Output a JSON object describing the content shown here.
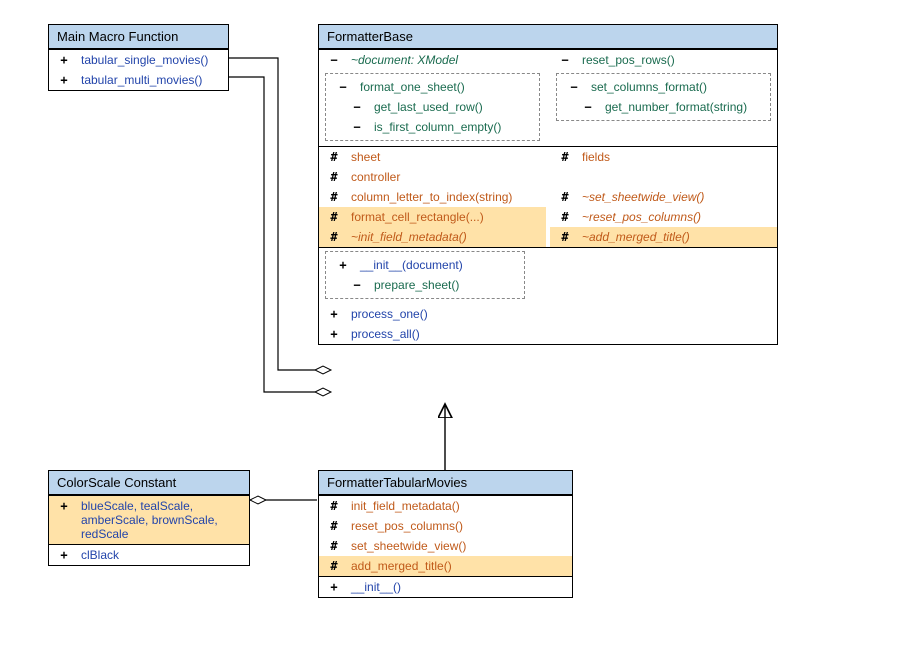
{
  "boxes": {
    "macro": {
      "title": "Main Macro Function",
      "items": [
        {
          "sym": "+",
          "cls": "public",
          "label": "tabular_single_movies()"
        },
        {
          "sym": "+",
          "cls": "public",
          "label": "tabular_multi_movies()"
        }
      ]
    },
    "colorscale": {
      "title": "ColorScale Constant",
      "items_hl": [
        {
          "sym": "+",
          "cls": "public",
          "label": "blueScale, tealScale, amberScale, brownScale, redScale"
        }
      ],
      "items": [
        {
          "sym": "+",
          "cls": "public",
          "label": "clBlack"
        }
      ]
    },
    "fbase": {
      "title": "FormatterBase",
      "sec_private_left": {
        "top": "~document: XModel",
        "group_head": "format_one_sheet()",
        "group_sub": [
          "get_last_used_row()",
          "is_first_column_empty()"
        ]
      },
      "sec_private_right": {
        "top": "reset_pos_rows()",
        "group_head": "set_columns_format()",
        "group_sub": [
          "get_number_format(string)"
        ]
      },
      "sec_prot_left": [
        {
          "sym": "#",
          "label": "sheet",
          "hl": false,
          "italic": false
        },
        {
          "sym": "#",
          "label": "controller",
          "hl": false,
          "italic": false
        },
        {
          "sym": "#",
          "label": "column_letter_to_index(string)",
          "hl": false,
          "italic": false
        },
        {
          "sym": "#",
          "label": "format_cell_rectangle(...)",
          "hl": true,
          "italic": false
        },
        {
          "sym": "#",
          "label": "~init_field_metadata()",
          "hl": true,
          "italic": true
        }
      ],
      "sec_prot_right": [
        {
          "sym": "#",
          "label": "fields",
          "hl": false,
          "italic": false
        },
        {
          "sym": "#",
          "label": "",
          "hl": false,
          "italic": false
        },
        {
          "sym": "#",
          "label": "~set_sheetwide_view()",
          "hl": false,
          "italic": true
        },
        {
          "sym": "#",
          "label": "~reset_pos_columns()",
          "hl": false,
          "italic": true
        },
        {
          "sym": "#",
          "label": "~add_merged_title()",
          "hl": true,
          "italic": true
        }
      ],
      "sec_public": {
        "init_head": "__init__(document)",
        "init_sub": "prepare_sheet()",
        "rest": [
          "process_one()",
          "process_all()"
        ]
      }
    },
    "ftm": {
      "title": "FormatterTabularMovies",
      "sec_prot": [
        {
          "sym": "#",
          "label": "init_field_metadata()",
          "hl": false
        },
        {
          "sym": "#",
          "label": "reset_pos_columns()",
          "hl": false
        },
        {
          "sym": "#",
          "label": "set_sheetwide_view()",
          "hl": false
        },
        {
          "sym": "#",
          "label": "add_merged_title()",
          "hl": true
        }
      ],
      "sec_pub": [
        {
          "sym": "+",
          "label": "__init__()"
        }
      ]
    }
  },
  "symbols": {
    "plus": "+",
    "minus": "−",
    "hash": "#"
  }
}
